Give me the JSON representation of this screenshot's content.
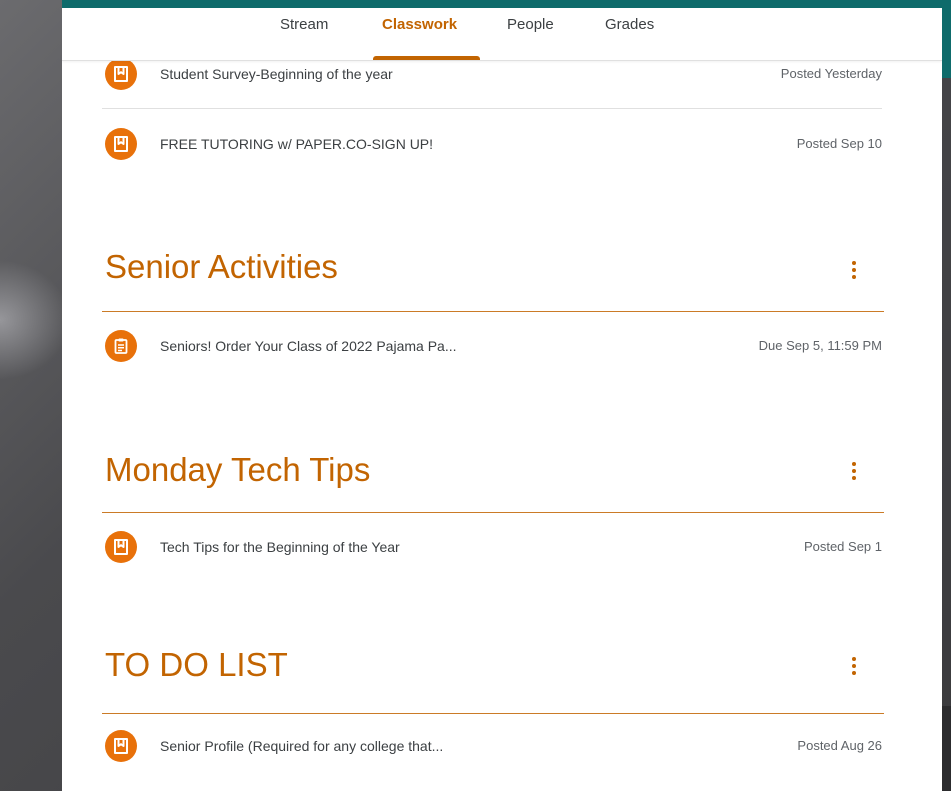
{
  "tabs": [
    {
      "label": "Stream"
    },
    {
      "label": "Classwork"
    },
    {
      "label": "People"
    },
    {
      "label": "Grades"
    }
  ],
  "active_tab": "Classwork",
  "accent_color": "#c26401",
  "icon_color": "#e8710a",
  "items_top": [
    {
      "title": "Student Survey-Beginning of the year",
      "meta": "Posted Yesterday",
      "icon": "material-icon"
    },
    {
      "title": "FREE TUTORING w/ PAPER.CO-SIGN UP!",
      "meta": "Posted Sep 10",
      "icon": "material-icon"
    }
  ],
  "topics": [
    {
      "title": "Senior Activities",
      "items": [
        {
          "title": "Seniors! Order Your Class of 2022 Pajama Pa...",
          "meta": "Due Sep 5, 11:59 PM",
          "icon": "assignment-icon"
        }
      ]
    },
    {
      "title": "Monday Tech Tips",
      "items": [
        {
          "title": "Tech Tips for the Beginning of the Year",
          "meta": "Posted Sep 1",
          "icon": "material-icon"
        }
      ]
    },
    {
      "title": "TO DO LIST",
      "items": [
        {
          "title": "Senior Profile (Required for any college that...",
          "meta": "Posted Aug 26",
          "icon": "material-icon"
        }
      ]
    }
  ]
}
